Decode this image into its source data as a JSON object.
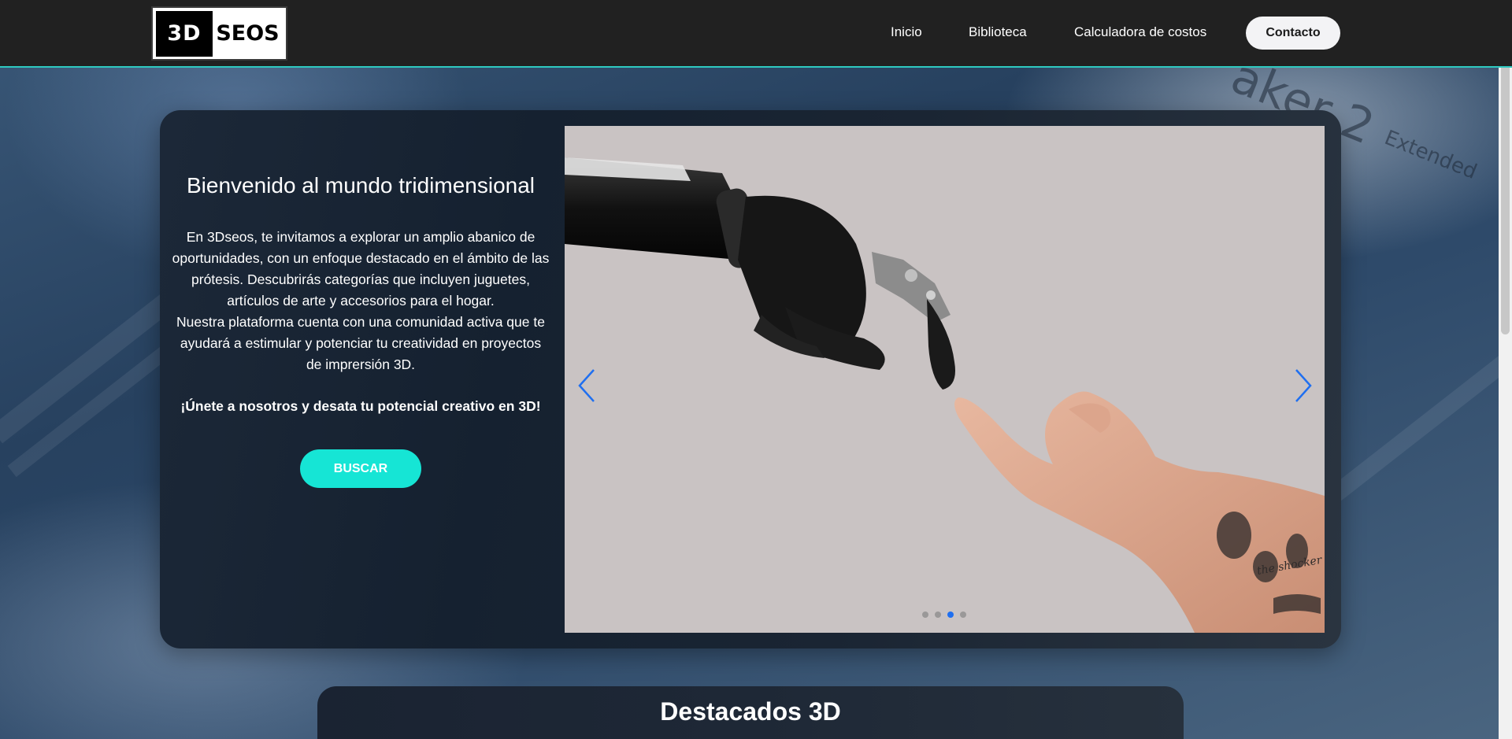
{
  "header": {
    "logo_left": "3D",
    "logo_right": "SEOS",
    "nav": [
      "Inicio",
      "Biblioteca",
      "Calculadora de costos"
    ],
    "contact_label": "Contacto"
  },
  "background": {
    "text_line1": "aker 2",
    "text_line2": "Extended"
  },
  "hero": {
    "title": "Bienvenido al mundo tridimensional",
    "paragraph1": "En 3Dseos, te invitamos a explorar un amplio abanico de oportunidades, con un enfoque destacado en el ámbito de las prótesis. Descubrirás categorías que incluyen juguetes, artículos de arte y accesorios para el hogar.",
    "paragraph2": "Nuestra plataforma cuenta con una comunidad activa que te ayudará a estimular y potenciar tu creatividad en proyectos de imprersión 3D.",
    "cta": "¡Únete a nosotros y desata tu potencial creativo en 3D!",
    "button_label": "BUSCAR"
  },
  "carousel": {
    "slide_count": 4,
    "active_index": 2,
    "slide_caption": "the shocker",
    "arrow_color": "#1f6ff0"
  },
  "featured": {
    "title": "Destacados 3D"
  },
  "colors": {
    "accent": "#16e5d5",
    "header_bg": "#212121",
    "header_border": "#2ec9c0",
    "active_dot": "#1f6ff0"
  }
}
